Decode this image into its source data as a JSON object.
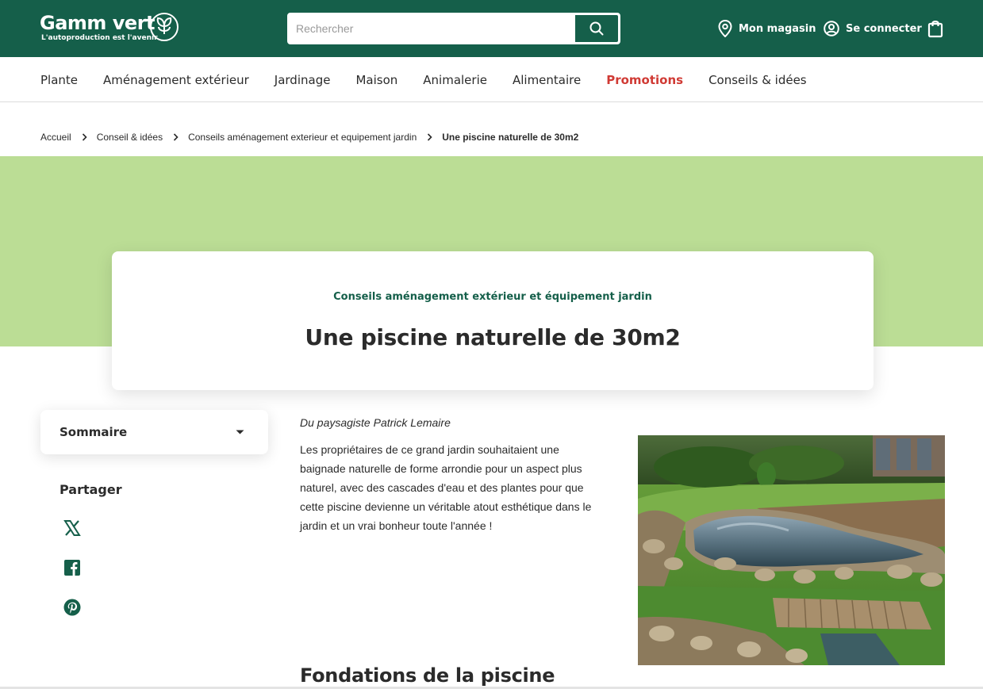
{
  "header": {
    "brand": "Gamm vert",
    "tagline": "L'autoproduction est l'avenir",
    "search_placeholder": "Rechercher",
    "store_label": "Mon magasin",
    "login_label": "Se connecter",
    "brand_color": "#155f4a"
  },
  "nav": {
    "items": [
      "Plante",
      "Aménagement extérieur",
      "Jardinage",
      "Maison",
      "Animalerie",
      "Alimentaire",
      "Promotions",
      "Conseils & idées"
    ],
    "promo_color": "#d03a34"
  },
  "breadcrumb": [
    "Accueil",
    "Conseil & idées",
    "Conseils aménagement exterieur et equipement jardin",
    "Une piscine naturelle de 30m2"
  ],
  "hero": {
    "category": "Conseils aménagement extérieur et équipement jardin",
    "title": "Une piscine naturelle de 30m2",
    "background_color": "#bbdd95"
  },
  "sidebar": {
    "sommaire_label": "Sommaire",
    "share_label": "Partager",
    "share_icons": [
      "x-icon",
      "facebook-icon",
      "pinterest-icon"
    ]
  },
  "article": {
    "author": "Du paysagiste Patrick Lemaire",
    "intro": "Les propriétaires de ce grand jardin souhaitaient une baignade naturelle de forme arrondie pour un aspect plus naturel, avec des cascades d'eau et des plantes pour que cette piscine devienne un véritable atout esthétique dans le jardin et un vrai bonheur toute l'année !",
    "section_title": "Fondations de la piscine"
  }
}
